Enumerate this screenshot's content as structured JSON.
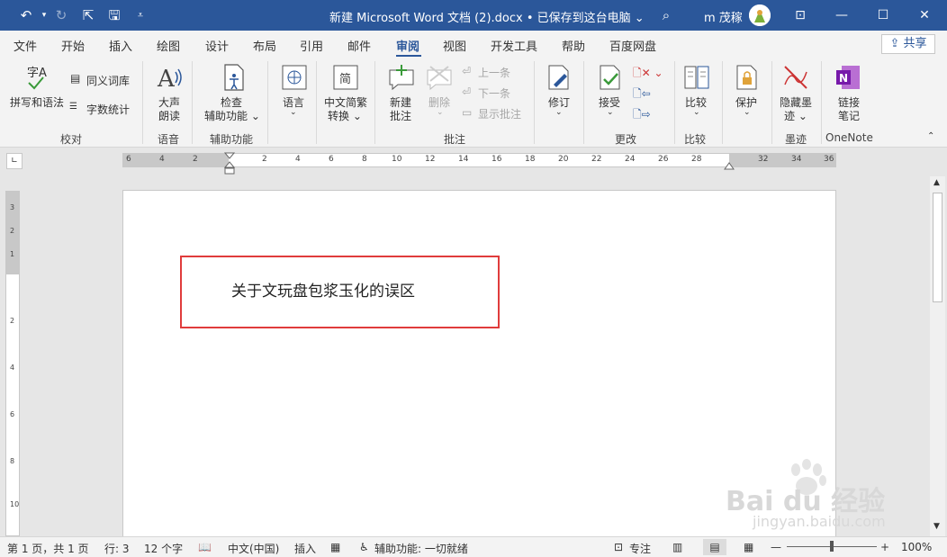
{
  "titlebar": {
    "title": "新建 Microsoft Word 文档 (2).docx • 已保存到这台电脑 ⌄",
    "user_name": "m 茂稼",
    "colors": {
      "accent": "#2b579a"
    }
  },
  "menu_tabs": [
    "文件",
    "开始",
    "插入",
    "绘图",
    "设计",
    "布局",
    "引用",
    "邮件",
    "审阅",
    "视图",
    "开发工具",
    "帮助",
    "百度网盘"
  ],
  "active_tab": "审阅",
  "share_label": "共享",
  "ribbon": {
    "groups": {
      "proofing": "校对",
      "speech": "语音",
      "accessibility": "辅助功能",
      "language_group": "",
      "comments": "批注",
      "changes": "更改",
      "compare": "比较",
      "ink": "墨迹",
      "onenote": "OneNote"
    },
    "buttons": {
      "spelling_icon_text": "字A",
      "spelling": "拼写和语法",
      "thesaurus": "同义词库",
      "word_count": "字数统计",
      "read_aloud_1": "大声",
      "read_aloud_2": "朗读",
      "check_1": "检查",
      "check_2": "辅助功能 ⌄",
      "language": "语言",
      "trad_simp_1": "中文简繁",
      "trad_simp_2": "转换 ⌄",
      "new_comment_1": "新建",
      "new_comment_2": "批注",
      "delete": "删除",
      "previous": "上一条",
      "next": "下一条",
      "show_comments": "显示批注",
      "track": "修订",
      "accept": "接受",
      "compare": "比较",
      "protect": "保护",
      "hide_ink_1": "隐藏墨",
      "hide_ink_2": "迹 ⌄",
      "link_notes_1": "链接",
      "link_notes_2": "笔记"
    }
  },
  "ruler": {
    "numbers": [
      "6",
      "4",
      "2",
      "2",
      "4",
      "6",
      "8",
      "10",
      "12",
      "14",
      "16",
      "18",
      "20",
      "22",
      "24",
      "26",
      "28",
      "32",
      "34",
      "36"
    ]
  },
  "document": {
    "text": "关于文玩盘包浆玉化的误区"
  },
  "statusbar": {
    "page": "第 1 页，共 1 页",
    "line": "行: 3",
    "words": "12 个字",
    "language": "中文(中国)",
    "mode": "插入",
    "accessibility": "辅助功能: 一切就绪",
    "focus": "专注",
    "zoom": "100%"
  },
  "watermark": {
    "line1": "Bai du 经验",
    "line2": "jingyan.baidu.com"
  }
}
